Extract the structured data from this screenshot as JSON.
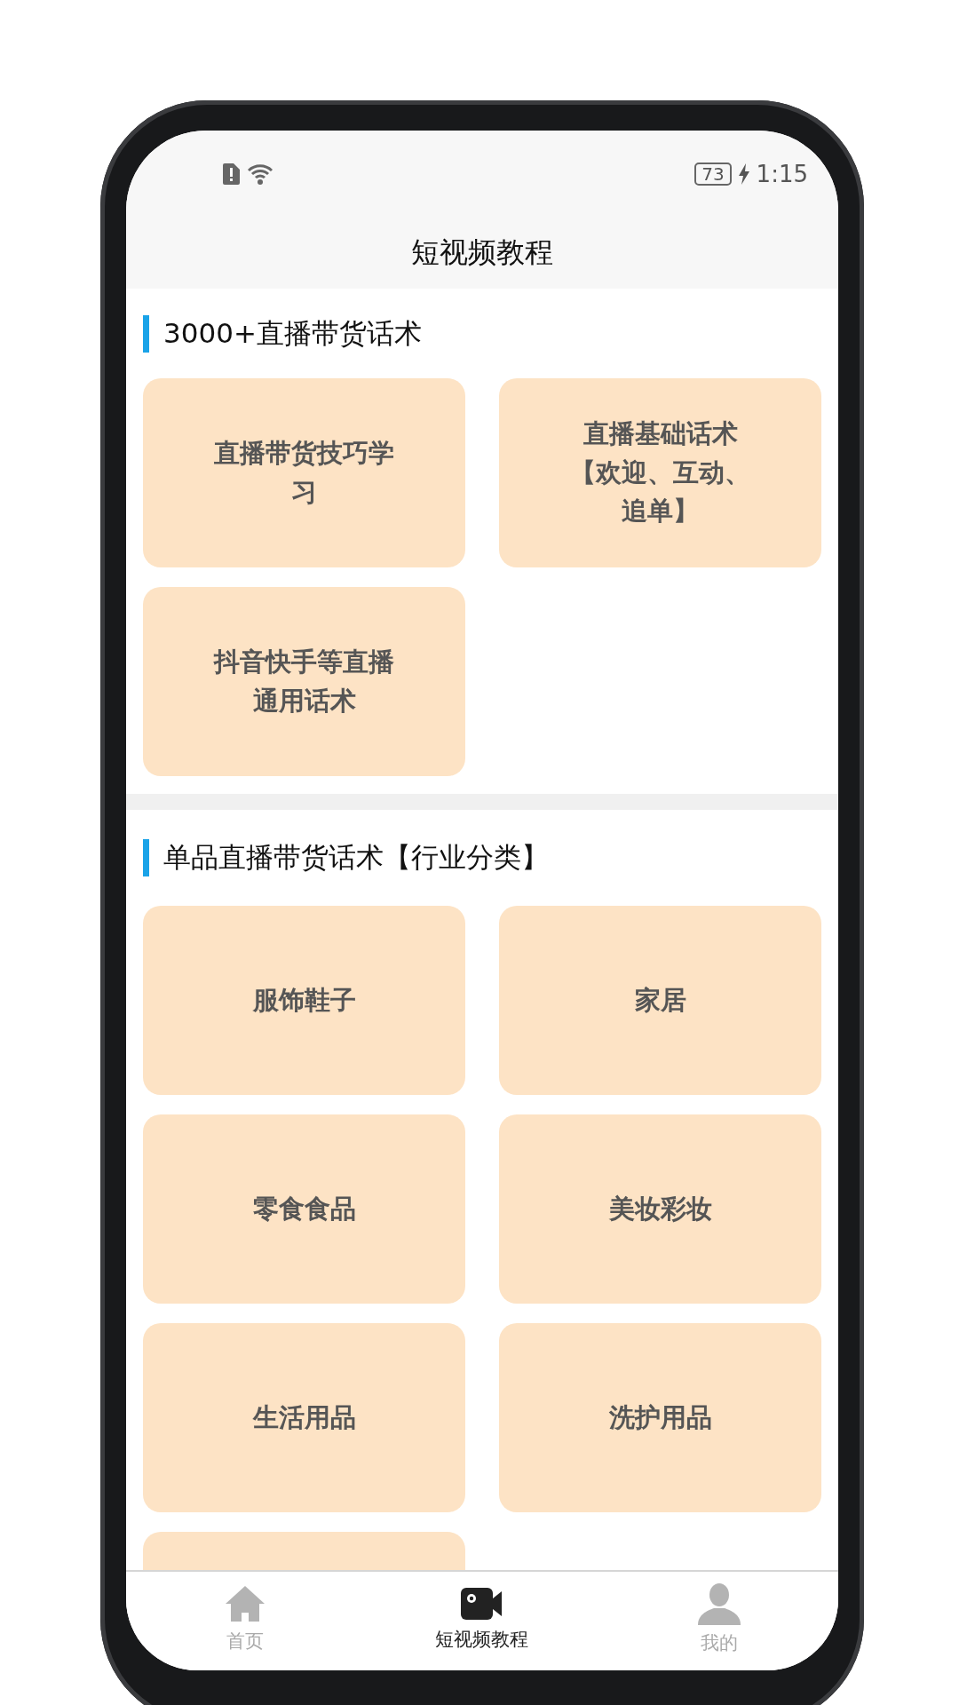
{
  "status_bar": {
    "battery": "73",
    "time": "1:15",
    "charging": true
  },
  "header": {
    "title": "短视频教程"
  },
  "sections": [
    {
      "title": "3000+直播带货话术",
      "items": [
        {
          "kind": "card",
          "label": "直播带货技巧学习"
        },
        {
          "kind": "card",
          "label": "直播基础话术【欢迎、互动、追单】"
        },
        {
          "kind": "card",
          "label": "抖音快手等直播通用话术"
        }
      ]
    },
    {
      "title": "单品直播带货话术【行业分类】",
      "items": [
        {
          "kind": "card",
          "label": "服饰鞋子"
        },
        {
          "kind": "card",
          "label": "家居"
        },
        {
          "kind": "card",
          "label": "零食食品"
        },
        {
          "kind": "card",
          "label": "美妆彩妆"
        },
        {
          "kind": "card",
          "label": "生活用品"
        },
        {
          "kind": "card",
          "label": "洗护用品"
        },
        {
          "kind": "blank"
        }
      ]
    }
  ],
  "tab_bar": [
    {
      "kind": "home",
      "label": "首页",
      "selected": false
    },
    {
      "kind": "video",
      "label": "短视频教程",
      "selected": true
    },
    {
      "kind": "person",
      "label": "我的",
      "selected": false
    }
  ]
}
